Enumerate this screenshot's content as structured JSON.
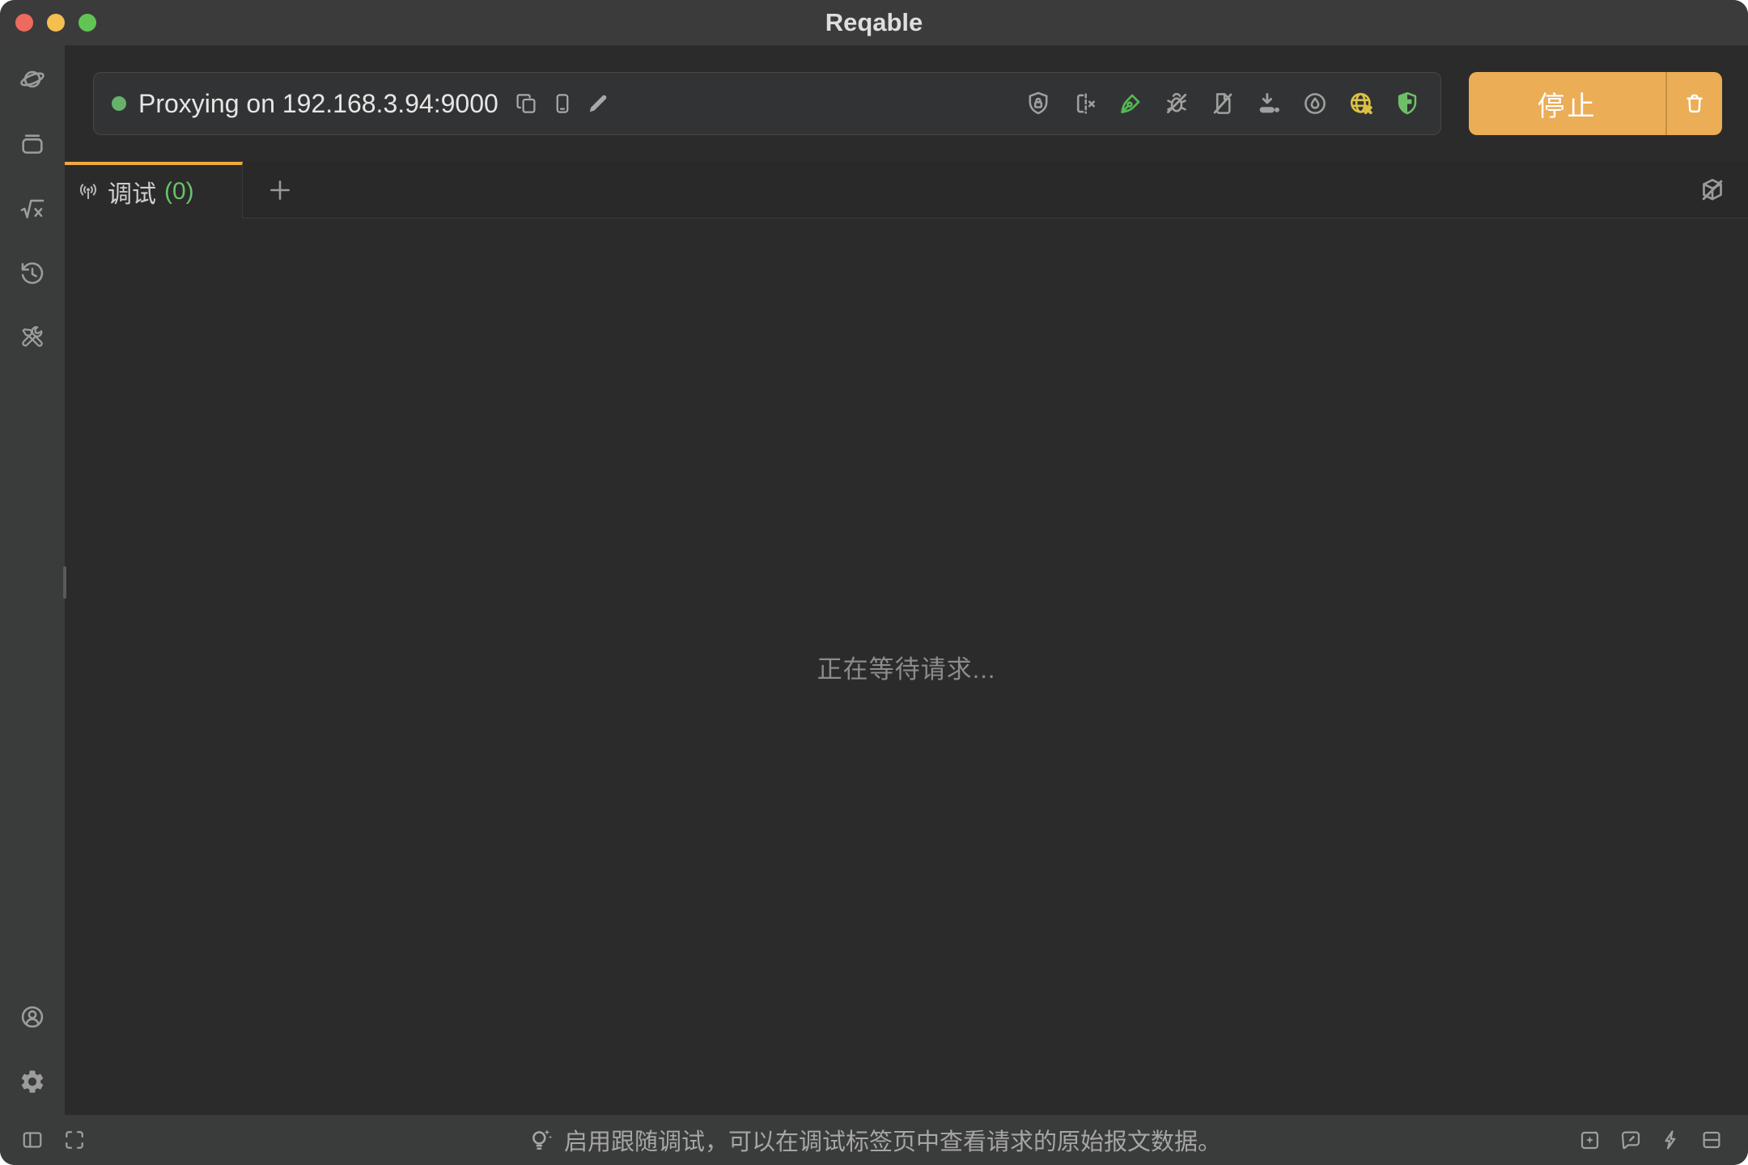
{
  "window": {
    "title": "Reqable"
  },
  "titlebar": {
    "traffic_lights": [
      "close",
      "minimize",
      "zoom"
    ]
  },
  "sidebar": {
    "top_icons": [
      "planet-traffic-icon",
      "collection-box-icon",
      "script-sqrt-icon",
      "history-clock-icon",
      "toolbox-icon"
    ],
    "bottom_icons": [
      "user-account-icon",
      "settings-gear-icon"
    ]
  },
  "toolbar": {
    "proxy_status": "Proxying on 192.168.3.94:9000",
    "quick_action_icons": [
      "copy-icon",
      "smartphone-icon",
      "edit-pencil-icon"
    ],
    "mode_icons": [
      "certificate-shield-lock-icon",
      "device-split-off-icon",
      "script-pen-icon",
      "debug-bug-off-icon",
      "rewrite-doc-off-icon",
      "download-collect-icon",
      "droplet-circle-icon",
      "globe-off-icon",
      "security-shield-icon"
    ],
    "stop_button": {
      "label": "停止",
      "icon": "trash-icon"
    }
  },
  "tabs": {
    "active": {
      "icon": "broadcast-icon",
      "label": "调试",
      "count": "(0)"
    },
    "add_button": "+",
    "right_icon": "preview-box-off-icon"
  },
  "content": {
    "empty_message": "正在等待请求..."
  },
  "statusbar": {
    "left_icons": [
      "panel-toggle-icon",
      "fullscreen-icon"
    ],
    "tip_icon": "lightbulb-sparkle-icon",
    "tip": "启用跟随调试，可以在调试标签页中查看请求的原始报文数据。",
    "right_icons": [
      "ai-sparkle-box-icon",
      "feedback-message-icon",
      "flash-bolt-icon",
      "split-rows-icon"
    ]
  },
  "colors": {
    "accent_orange": "#f2a93c",
    "button_orange": "#ebad55",
    "success_green": "#67b26a",
    "pen_green": "#55b855",
    "globe_yellow": "#dcc145",
    "shield_green": "#6fbf69",
    "titlebar_bg": "#3b3b3b",
    "sidebar_bg": "#3a3b3b",
    "content_bg": "#2b2b2b",
    "panel_bg": "#323334"
  }
}
